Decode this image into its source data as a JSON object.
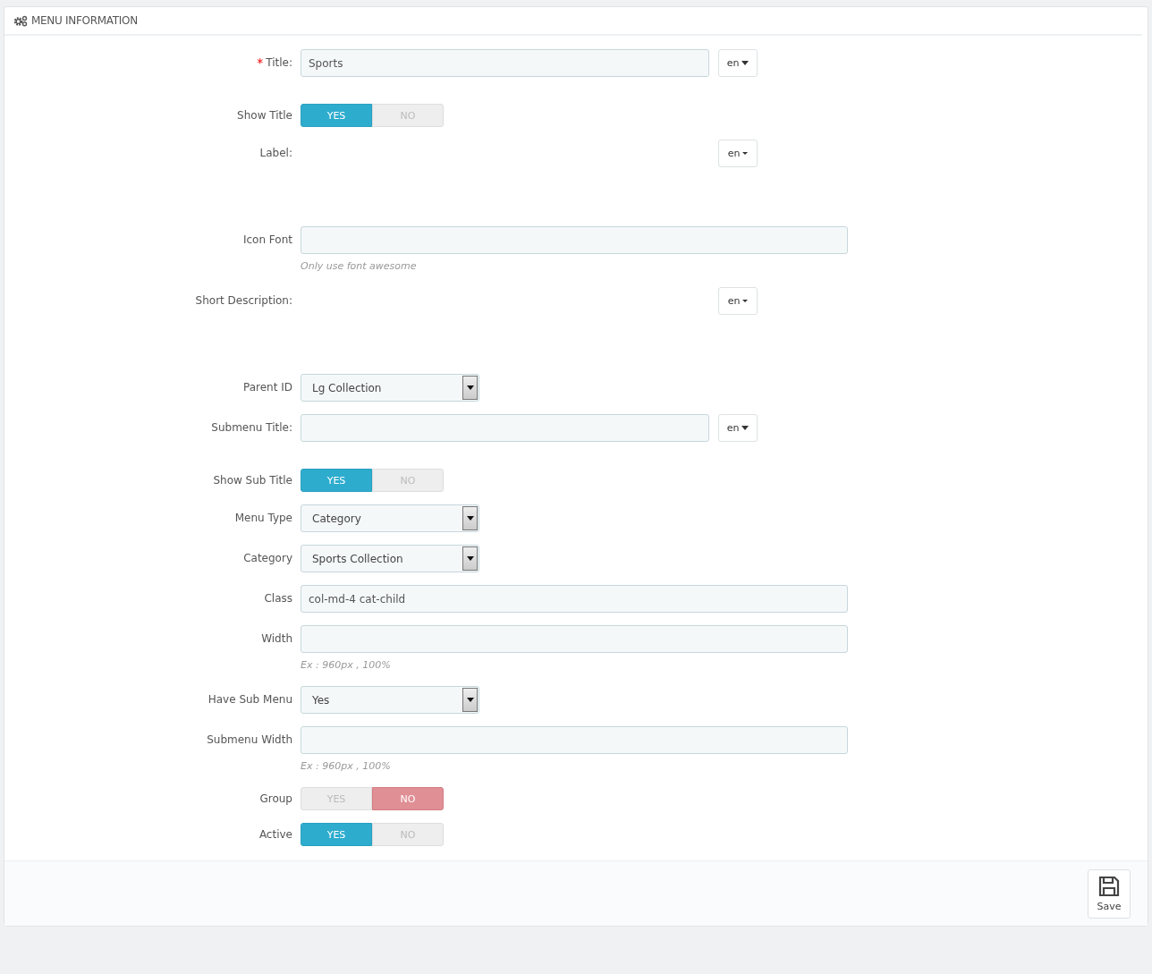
{
  "panel": {
    "title": "MENU INFORMATION"
  },
  "fields": [
    {
      "kind": "text",
      "label": "Title:",
      "required_mark": "*",
      "value": "Sports",
      "lang": "en"
    },
    {
      "kind": "switch",
      "label": "Show Title",
      "yes": "YES",
      "no": "NO",
      "on": true
    },
    {
      "kind": "lang",
      "label": "Label:",
      "lang": "en"
    },
    {
      "kind": "text",
      "label": "Icon Font",
      "hint": "Only use font awesome"
    },
    {
      "kind": "lang",
      "label": "Short Description:",
      "lang": "en"
    },
    {
      "kind": "select",
      "label": "Parent ID",
      "value": "Lg Collection"
    },
    {
      "kind": "text",
      "label": "Submenu Title:",
      "lang": "en"
    },
    {
      "kind": "switch",
      "label": "Show Sub Title",
      "yes": "YES",
      "no": "NO",
      "on": true
    },
    {
      "kind": "select",
      "label": "Menu Type",
      "value": "Category"
    },
    {
      "kind": "select",
      "label": "Category",
      "value": "Sports Collection"
    },
    {
      "kind": "text",
      "label": "Class",
      "value": "col-md-4 cat-child"
    },
    {
      "kind": "text",
      "label": "Width",
      "hint": "Ex : 960px , 100%"
    },
    {
      "kind": "select",
      "label": "Have Sub Menu",
      "value": "Yes"
    },
    {
      "kind": "text",
      "label": "Submenu Width",
      "hint": "Ex : 960px , 100%"
    },
    {
      "kind": "switch",
      "label": "Group",
      "yes": "YES",
      "no": "NO",
      "on": false
    },
    {
      "kind": "switch",
      "label": "Active",
      "yes": "YES",
      "no": "NO",
      "on": true
    }
  ],
  "save_button": "Save"
}
